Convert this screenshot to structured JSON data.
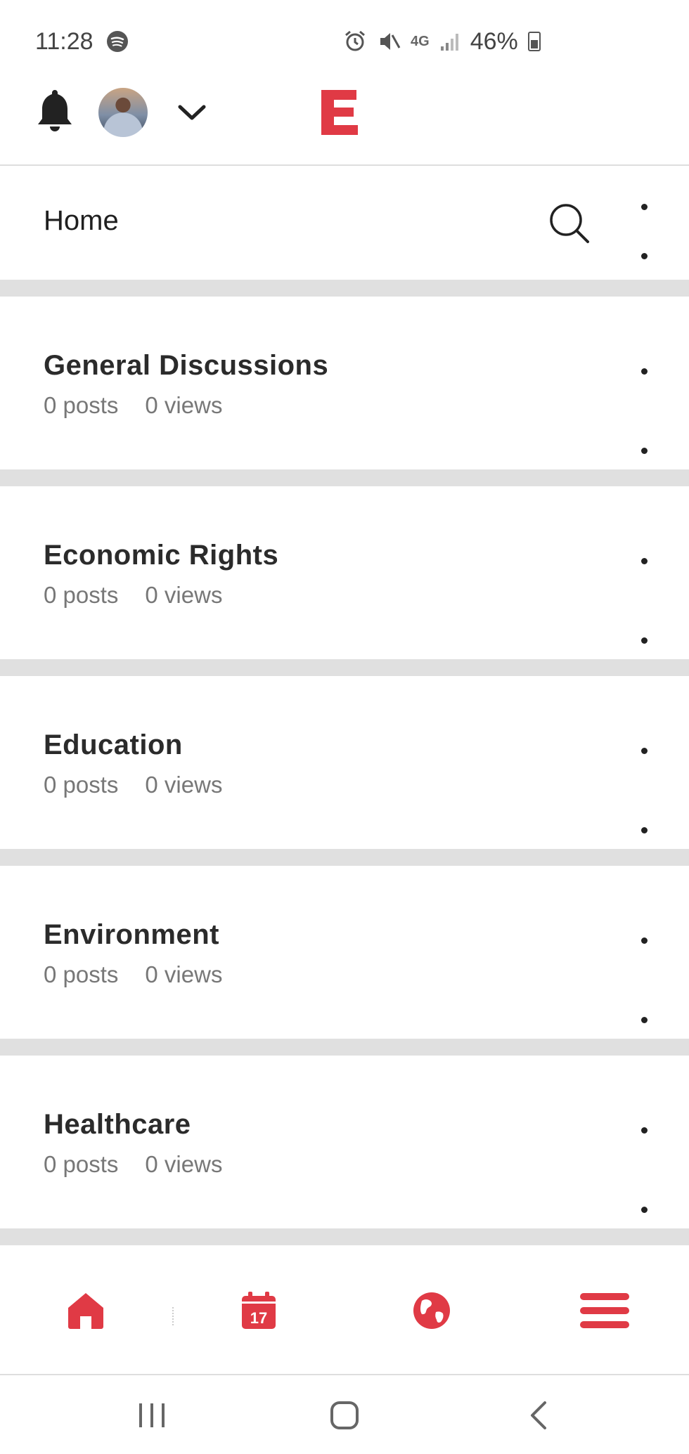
{
  "status_bar": {
    "time": "11:28",
    "battery": "46%",
    "network": "4G",
    "icons": [
      "spotify-icon",
      "alarm-icon",
      "mute-icon",
      "signal-icon",
      "battery-icon"
    ]
  },
  "app_bar": {
    "logo_letter": "E",
    "brand_color": "#e03a45",
    "icons": [
      "bell-icon",
      "avatar",
      "chevron-down-icon"
    ]
  },
  "header": {
    "title": "Home",
    "icons": [
      "search-icon",
      "more-vert-icon"
    ]
  },
  "categories": [
    {
      "title": "General Discussions",
      "posts": "0 posts",
      "views": "0 views"
    },
    {
      "title": "Economic Rights",
      "posts": "0 posts",
      "views": "0 views"
    },
    {
      "title": "Education",
      "posts": "0 posts",
      "views": "0 views"
    },
    {
      "title": "Environment",
      "posts": "0 posts",
      "views": "0 views"
    },
    {
      "title": "Healthcare",
      "posts": "0 posts",
      "views": "0 views"
    }
  ],
  "bottom_nav": {
    "items": [
      "home-icon",
      "calendar-icon",
      "globe-icon",
      "menu-icon"
    ],
    "calendar_day": "17",
    "accent": "#e03a45"
  },
  "system_nav": {
    "items": [
      "recents-icon",
      "home-circle-icon",
      "back-icon"
    ]
  }
}
